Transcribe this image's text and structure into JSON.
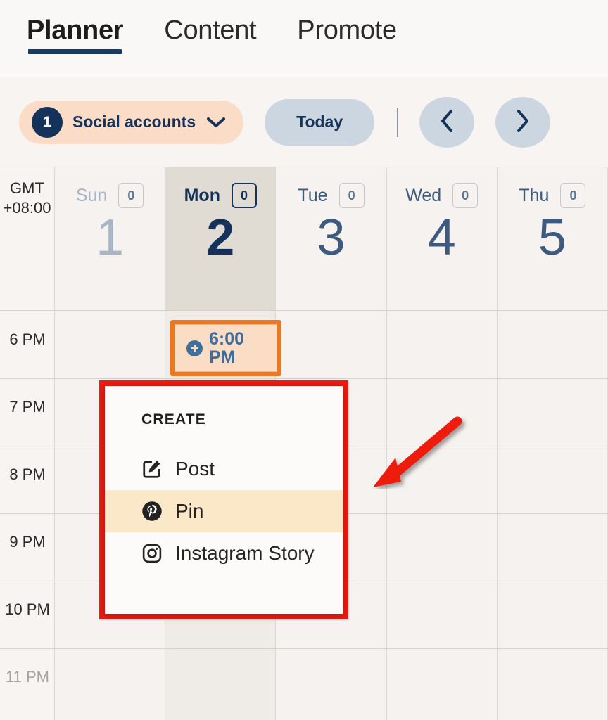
{
  "tabs": [
    {
      "label": "Planner",
      "active": true
    },
    {
      "label": "Content",
      "active": false
    },
    {
      "label": "Promote",
      "active": false
    }
  ],
  "toolbar": {
    "accounts_count": "1",
    "accounts_label": "Social accounts",
    "chevron_icon": "chevron-down-icon",
    "today_label": "Today",
    "prev_icon": "chevron-left-icon",
    "next_icon": "chevron-right-icon"
  },
  "calendar": {
    "timezone_line1": "GMT",
    "timezone_line2": "+08:00",
    "days": [
      {
        "name": "Sun",
        "number": "1",
        "count": "0",
        "state": "past"
      },
      {
        "name": "Mon",
        "number": "2",
        "count": "0",
        "state": "today"
      },
      {
        "name": "Tue",
        "number": "3",
        "count": "0",
        "state": "normal"
      },
      {
        "name": "Wed",
        "number": "4",
        "count": "0",
        "state": "normal"
      },
      {
        "name": "Thu",
        "number": "5",
        "count": "0",
        "state": "normal"
      }
    ],
    "hours": [
      {
        "label": "6 PM",
        "dim": false
      },
      {
        "label": "7 PM",
        "dim": false
      },
      {
        "label": "8 PM",
        "dim": false
      },
      {
        "label": "9 PM",
        "dim": false
      },
      {
        "label": "10 PM",
        "dim": false
      },
      {
        "label": "11 PM",
        "dim": true
      }
    ],
    "event": {
      "time_line1": "6:00",
      "time_line2": "PM",
      "add_icon": "plus-circle-icon",
      "border_color": "#ee7722",
      "fill_color": "#fbddc5",
      "text_color": "#3d6f9e"
    }
  },
  "create_menu": {
    "title": "CREATE",
    "items": [
      {
        "label": "Post",
        "icon": "compose-post-icon",
        "highlighted": false
      },
      {
        "label": "Pin",
        "icon": "pinterest-icon",
        "highlighted": true
      },
      {
        "label": "Instagram Story",
        "icon": "instagram-icon",
        "highlighted": false
      }
    ],
    "highlight_color": "#fbe8c8",
    "annotation_color": "#ee1b11"
  },
  "annotation": {
    "arrow_icon": "red-arrow-pointing-down-left",
    "color": "#ee1b11"
  }
}
